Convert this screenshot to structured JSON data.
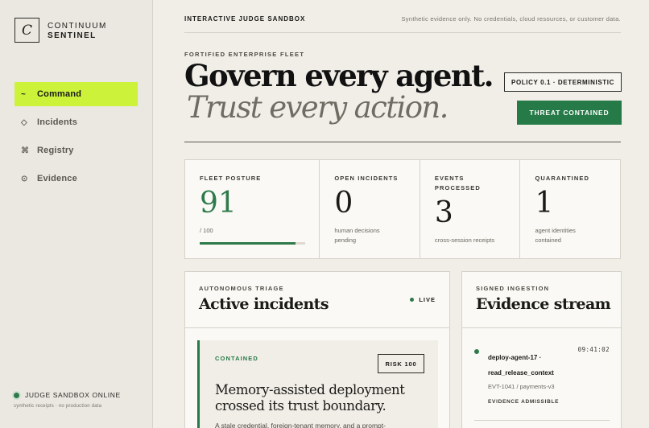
{
  "brand": {
    "logo_letter": "C",
    "line1": "CONTINUUM",
    "line2": "SENTINEL"
  },
  "nav": [
    {
      "icon": "~",
      "label": "Command",
      "active": true
    },
    {
      "icon": "◇",
      "label": "Incidents"
    },
    {
      "icon": "⌘",
      "label": "Registry"
    },
    {
      "icon": "⊙",
      "label": "Evidence"
    }
  ],
  "status": {
    "label": "JUDGE SANDBOX ONLINE",
    "sub": "synthetic receipts · no production data"
  },
  "topbar": {
    "title": "INTERACTIVE JUDGE SANDBOX",
    "note": "Synthetic evidence only. No credentials, cloud resources, or customer data."
  },
  "hero": {
    "eyebrow": "FORTIFIED ENTERPRISE FLEET",
    "line1": "Govern every agent.",
    "line2": "Trust every action."
  },
  "policy_label": "POLICY 0.1 · DETERMINISTIC",
  "threat_button": "THREAT CONTAINED",
  "stats": {
    "posture": {
      "label": "FLEET POSTURE",
      "value": "91",
      "sub": "/ 100",
      "fraction": 0.91
    },
    "incidents": {
      "label": "OPEN INCIDENTS",
      "value": "0",
      "sub1": "human decisions",
      "sub2": "pending"
    },
    "events": {
      "label1": "EVENTS",
      "label2": "PROCESSED",
      "value": "3",
      "sub": "cross-session receipts"
    },
    "quarantined": {
      "label": "QUARANTINED",
      "value": "1",
      "sub1": "agent identities",
      "sub2": "contained"
    }
  },
  "triage": {
    "eyebrow": "AUTONOMOUS TRIAGE",
    "title": "Active incidents",
    "live": "LIVE",
    "incident": {
      "tag": "CONTAINED",
      "risk": "RISK 100",
      "title": "Memory-assisted deployment crossed its trust boundary.",
      "body": "A stale credential, foreign-tenant memory, and a prompt-"
    }
  },
  "stream": {
    "eyebrow": "SIGNED INGESTION",
    "title": "Evidence stream",
    "event": {
      "time": "09:41:02",
      "name1": "deploy-agent-17 ·",
      "name2": "read_release_context",
      "id": "EVT-1041 / payments-v3",
      "status": "EVIDENCE ADMISSIBLE"
    }
  },
  "colors": {
    "accent_lime": "#ccf23a",
    "brand_green": "#267a47",
    "background": "#f1eee7"
  }
}
